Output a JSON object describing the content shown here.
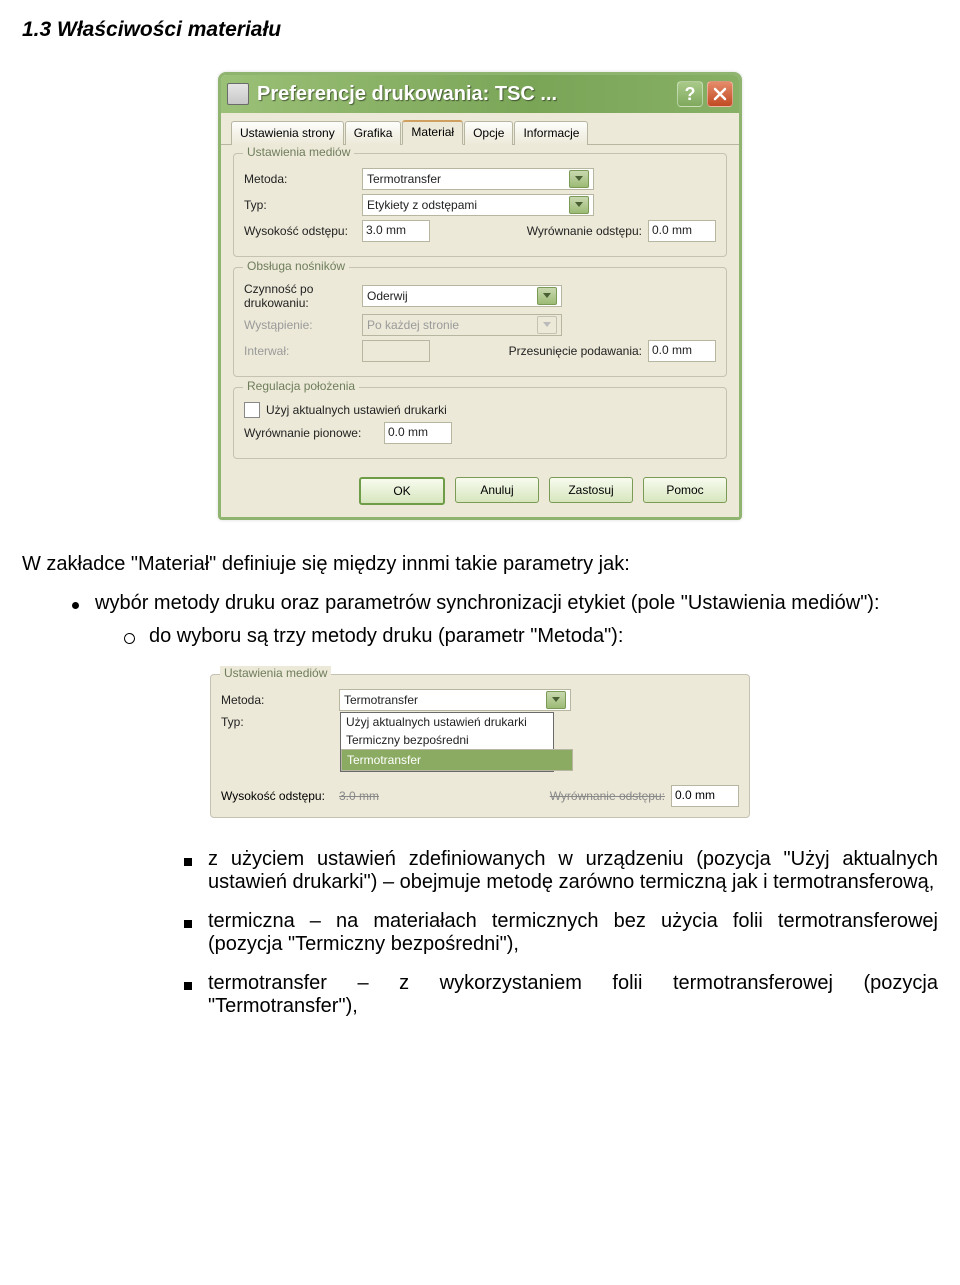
{
  "page": {
    "section_title": "1.3 Właściwości materiału"
  },
  "dialog": {
    "title": "Preferencje drukowania: TSC ...",
    "tabs": [
      "Ustawienia strony",
      "Grafika",
      "Materiał",
      "Opcje",
      "Informacje"
    ],
    "active_tab": "Materiał"
  },
  "group_media": {
    "title": "Ustawienia mediów",
    "metoda_label": "Metoda:",
    "metoda_value": "Termotransfer",
    "typ_label": "Typ:",
    "typ_value": "Etykiety z odstępami",
    "wys_label": "Wysokość odstępu:",
    "wys_value": "3.0 mm",
    "wyr_label": "Wyrównanie odstępu:",
    "wyr_value": "0.0 mm"
  },
  "group_handling": {
    "title": "Obsługa nośników",
    "czynnosc_label": "Czynność po drukowaniu:",
    "czynnosc_value": "Oderwij",
    "wystapienie_label": "Wystąpienie:",
    "wystapienie_value": "Po każdej stronie",
    "interwal_label": "Interwał:",
    "interwal_value": "",
    "przesuniecie_label": "Przesunięcie podawania:",
    "przesuniecie_value": "0.0 mm"
  },
  "group_position": {
    "title": "Regulacja położenia",
    "check_label": "Użyj aktualnych ustawień drukarki",
    "vert_label": "Wyrównanie pionowe:",
    "vert_value": "0.0 mm"
  },
  "buttons": {
    "ok": "OK",
    "anuluj": "Anuluj",
    "zastosuj": "Zastosuj",
    "pomoc": "Pomoc"
  },
  "frag": {
    "title": "Ustawienia mediów",
    "metoda_label": "Metoda:",
    "metoda_value": "Termotransfer",
    "typ_label": "Typ:",
    "options": [
      "Użyj aktualnych ustawień drukarki",
      "Termiczny bezpośredni",
      "Termotransfer"
    ],
    "selected": "Termotransfer",
    "wys_label": "Wysokość odstępu:",
    "wys_strike": "3.0 mm",
    "wyr_strike": "Wyrównanie odstępu:",
    "wyr_value": "0.0 mm"
  },
  "text": {
    "intro": "W zakładce \"Materiał\" definiuje się między innmi takie parametry jak:",
    "b1": "wybór metody druku oraz parametrów synchronizacji etykiet (pole \"Ustawienia mediów\"):",
    "b2": "do wyboru są trzy metody druku (parametr \"Metoda\"):",
    "s1": "z użyciem ustawień zdefiniowanych w urządzeniu (pozycja \"Użyj aktualnych ustawień drukarki\") – obejmuje metodę zarówno termiczną jak i termotransferową,",
    "s2": "termiczna – na materiałach termicznych bez użycia folii termotransferowej (pozycja \"Termiczny bezpośredni\"),",
    "s3": "termotransfer – z wykorzystaniem folii termotransferowej (pozycja \"Termotransfer\"),"
  }
}
